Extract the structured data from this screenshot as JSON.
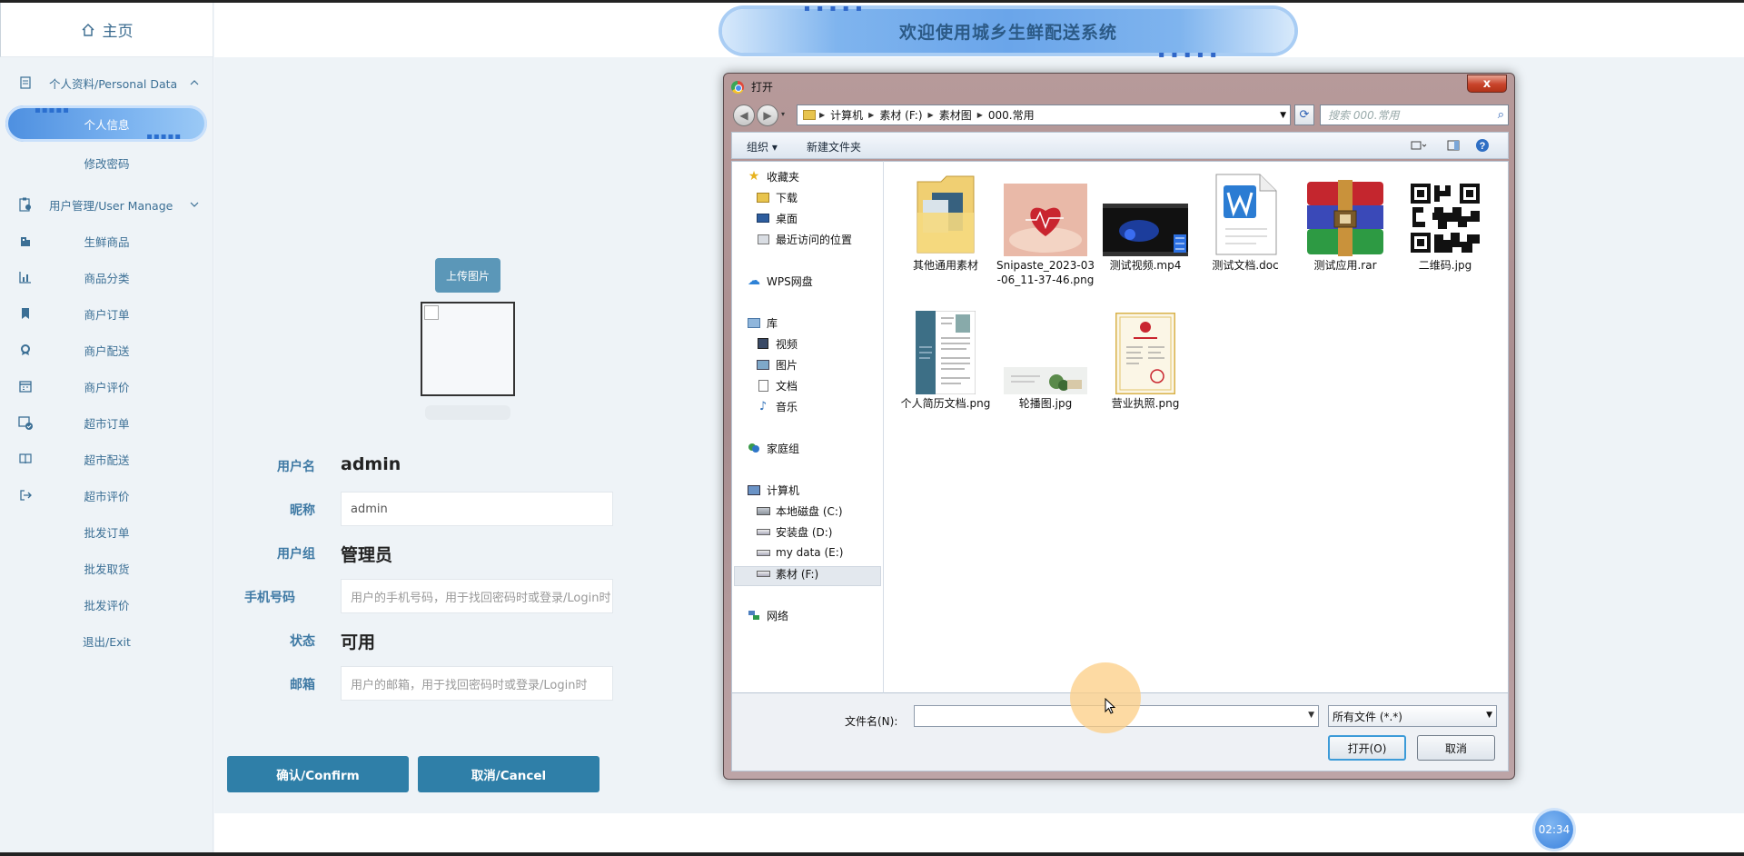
{
  "app": {
    "home_label": "主页",
    "banner_title": "欢迎使用城乡生鲜配送系统",
    "clock": "02:34"
  },
  "sidebar": {
    "groups": [
      {
        "label": "个人资料/Personal Data",
        "icon": "document-icon"
      },
      {
        "label": "用户管理/User Manage",
        "icon": "clipboard-user-icon"
      }
    ],
    "items": [
      {
        "label": "个人信息",
        "icon": ""
      },
      {
        "label": "修改密码",
        "icon": ""
      },
      {
        "label": "生鲜商品",
        "icon": "building-icon"
      },
      {
        "label": "商品分类",
        "icon": "chart-icon"
      },
      {
        "label": "商户订单",
        "icon": "bookmark-icon"
      },
      {
        "label": "商户配送",
        "icon": "award-icon"
      },
      {
        "label": "商户评价",
        "icon": "calendar-icon"
      },
      {
        "label": "超市订单",
        "icon": "calendar-check-icon"
      },
      {
        "label": "超市配送",
        "icon": "book-icon"
      },
      {
        "label": "超市评价",
        "icon": "logout-icon"
      },
      {
        "label": "批发订单",
        "icon": ""
      },
      {
        "label": "批发取货",
        "icon": ""
      },
      {
        "label": "批发评价",
        "icon": ""
      },
      {
        "label": "退出/Exit",
        "icon": ""
      }
    ]
  },
  "form": {
    "upload_label": "上传图片",
    "username_label": "用户名",
    "username_value": "admin",
    "nickname_label": "昵称",
    "nickname_value": "admin",
    "group_label": "用户组",
    "group_value": "管理员",
    "phone_label": "手机号码",
    "phone_placeholder": "用户的手机号码，用于找回密码时或登录/Login时",
    "status_label": "状态",
    "status_value": "可用",
    "email_label": "邮箱",
    "email_placeholder": "用户的邮箱，用于找回密码时或登录/Login时",
    "confirm_label": "确认/Confirm",
    "cancel_label": "取消/Cancel"
  },
  "dialog": {
    "title": "打开",
    "close": "x",
    "address": [
      "计算机",
      "素材 (F:)",
      "素材图",
      "000.常用"
    ],
    "search_placeholder": "搜索 000.常用",
    "toolbar": {
      "organize": "组织 ▾",
      "new_folder": "新建文件夹"
    },
    "nav": {
      "favorites": "收藏夹",
      "downloads": "下载",
      "desktop": "桌面",
      "recent": "最近访问的位置",
      "wps": "WPS网盘",
      "library": "库",
      "videos": "视频",
      "pictures": "图片",
      "documents": "文档",
      "music": "音乐",
      "homegroup": "家庭组",
      "computer": "计算机",
      "drive_c": "本地磁盘 (C:)",
      "drive_d": "安装盘 (D:)",
      "drive_e": "my data (E:)",
      "drive_f": "素材 (F:)",
      "network": "网络"
    },
    "files": [
      {
        "name": "其他通用素材",
        "icon": "folder-icon"
      },
      {
        "name": "Snipaste_2023-03-06_11-37-46.png",
        "icon": "image-heart-icon"
      },
      {
        "name": "测试视频.mp4",
        "icon": "video-icon"
      },
      {
        "name": "测试文档.doc",
        "icon": "word-doc-icon"
      },
      {
        "name": "测试应用.rar",
        "icon": "rar-archive-icon"
      },
      {
        "name": "二维码.jpg",
        "icon": "qr-code-icon"
      },
      {
        "name": "个人简历文档.png",
        "icon": "resume-icon"
      },
      {
        "name": "轮播图.jpg",
        "icon": "banner-image-icon"
      },
      {
        "name": "营业执照.png",
        "icon": "license-icon"
      }
    ],
    "filename_label": "文件名(N):",
    "filename_value": "",
    "filetype_value": "所有文件 (*.*)",
    "open_label": "打开(O)",
    "cancel_label": "取消"
  }
}
